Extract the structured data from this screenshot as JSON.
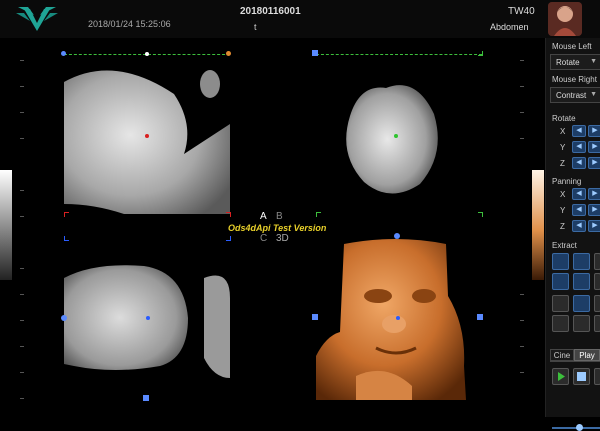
{
  "header": {
    "datetime": "2018/01/24 15:25:06",
    "patient_id": "20180116001",
    "patient_name": "t",
    "probe": "TW40",
    "preset": "Abdomen"
  },
  "viewport": {
    "quad_labels": {
      "a": "A",
      "b": "B",
      "c": "C",
      "d": "3D"
    },
    "watermark": "Ods4dApi Test Version"
  },
  "panel": {
    "mouse_left_label": "Mouse Left",
    "mouse_left_value": "Rotate",
    "mouse_right_label": "Mouse Right",
    "mouse_right_value": "Contrast",
    "rotate_label": "Rotate",
    "panning_label": "Panning",
    "axes": [
      "X",
      "Y",
      "Z"
    ],
    "extract_label": "Extract",
    "tabs": {
      "cine": "Cine",
      "play": "Play"
    }
  },
  "colors": {
    "accent": "#3b6aa3",
    "crosshair_green": "#3cbf3c",
    "crosshair_red": "#d82020",
    "crosshair_blue": "#2a5cff",
    "watermark": "#e8d02a"
  },
  "icons": {
    "logo": "wing-logo-icon",
    "avatar": "patient-avatar-icon",
    "play": "play-icon",
    "record": "record-icon",
    "dropdown": "chevron-down-icon"
  }
}
